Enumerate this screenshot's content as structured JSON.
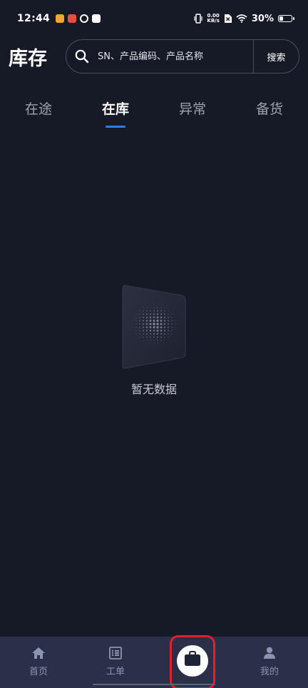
{
  "status_bar": {
    "time": "12:44",
    "net_speed_value": "0.00",
    "net_speed_unit": "KB/s",
    "battery_percent": "30%",
    "battery_level": 0.3
  },
  "header": {
    "title": "库存",
    "search_placeholder": "SN、产品编码、产品名称",
    "search_button": "搜索"
  },
  "tabs": [
    {
      "label": "在途",
      "active": false
    },
    {
      "label": "在库",
      "active": true
    },
    {
      "label": "异常",
      "active": false
    },
    {
      "label": "备货",
      "active": false
    }
  ],
  "empty_state": {
    "text": "暂无数据"
  },
  "bottom_nav": {
    "items": [
      {
        "label": "首页",
        "icon": "home-icon"
      },
      {
        "label": "工单",
        "icon": "list-icon"
      },
      {
        "label": "",
        "icon": "briefcase-icon"
      },
      {
        "label": "我的",
        "icon": "user-icon"
      }
    ]
  },
  "colors": {
    "background": "#161a27",
    "nav_background": "#2b2f47",
    "accent": "#2f7bea",
    "highlight": "#e0212d"
  }
}
